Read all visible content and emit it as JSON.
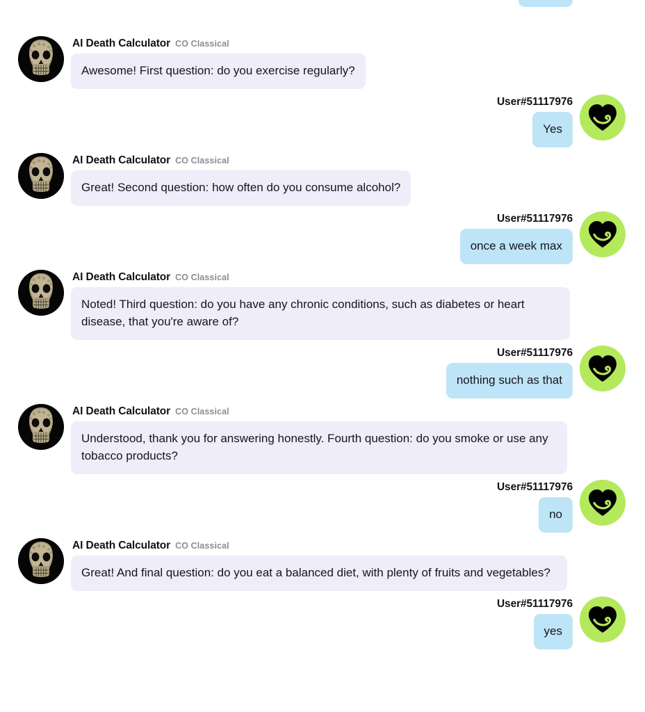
{
  "theme": {
    "page_background": "#ffffff",
    "bot_bubble_color": "#eeedf9",
    "user_bubble_color": "#bee4f7",
    "user_avatar_color": "#b4e95c",
    "bot_avatar_color": "#050505",
    "text_color": "#16161c",
    "badge_color": "#8c8c96"
  },
  "participants": {
    "bot": {
      "name": "AI Death Calculator",
      "badge": "CO Classical",
      "avatar_icon": "skull-avatar"
    },
    "user": {
      "name": "User#51117976",
      "avatar_icon": "heart-avatar"
    }
  },
  "messages": [
    {
      "id": "m0",
      "role": "user",
      "sender": "User#51117976",
      "text": "",
      "clipped": true
    },
    {
      "id": "m1",
      "role": "bot",
      "sender": "AI Death Calculator",
      "badge": "CO Classical",
      "text": "Awesome! First question: do you exercise regularly?"
    },
    {
      "id": "m2",
      "role": "user",
      "sender": "User#51117976",
      "text": "Yes"
    },
    {
      "id": "m3",
      "role": "bot",
      "sender": "AI Death Calculator",
      "badge": "CO Classical",
      "text": "Great! Second question: how often do you consume alcohol?"
    },
    {
      "id": "m4",
      "role": "user",
      "sender": "User#51117976",
      "text": "once a week max"
    },
    {
      "id": "m5",
      "role": "bot",
      "sender": "AI Death Calculator",
      "badge": "CO Classical",
      "text": "Noted! Third question: do you have any chronic conditions, such as diabetes or heart disease, that you're aware of?"
    },
    {
      "id": "m6",
      "role": "user",
      "sender": "User#51117976",
      "text": "nothing such as that"
    },
    {
      "id": "m7",
      "role": "bot",
      "sender": "AI Death Calculator",
      "badge": "CO Classical",
      "text": "Understood, thank you for answering honestly. Fourth question: do you smoke or use any tobacco products?"
    },
    {
      "id": "m8",
      "role": "user",
      "sender": "User#51117976",
      "text": "no"
    },
    {
      "id": "m9",
      "role": "bot",
      "sender": "AI Death Calculator",
      "badge": "CO Classical",
      "text": "Great! And final question: do you eat a balanced diet, with plenty of fruits and vegetables?"
    },
    {
      "id": "m10",
      "role": "user",
      "sender": "User#51117976",
      "text": "yes"
    }
  ]
}
